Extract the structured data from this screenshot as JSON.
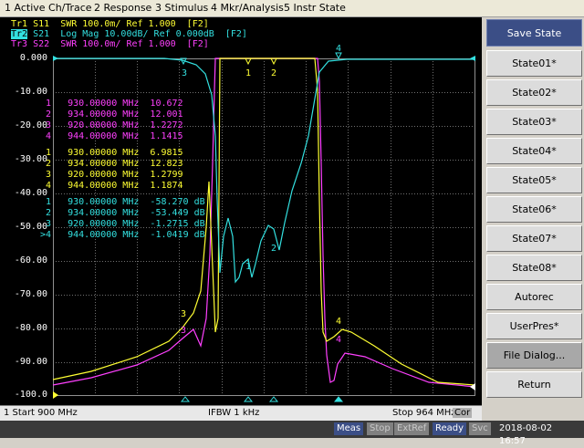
{
  "menu": [
    "1 Active Ch/Trace",
    "2 Response",
    "3 Stimulus",
    "4 Mkr/Analysis",
    "5 Instr State"
  ],
  "traces": [
    {
      "id": "Tr1",
      "text": "S11  SWR 100.0m/ Ref 1.000  [F2]",
      "color": "#ffff33"
    },
    {
      "id": "Tr2",
      "text": "S21  Log Mag 10.00dB/ Ref 0.000dB  [F2]",
      "color": "#33e0e0"
    },
    {
      "id": "Tr3",
      "text": "S22  SWR 100.0m/ Ref 1.000  [F2]",
      "color": "#ff40ff"
    }
  ],
  "y_axis_labels": [
    "0.000",
    "-10.00",
    "-20.00",
    "-30.00",
    "-40.00",
    "-50.00",
    "-60.00",
    "-70.00",
    "-80.00",
    "-90.00",
    "-100.0"
  ],
  "marker_tables": [
    {
      "color": "#ff40ff",
      "rows": [
        {
          "num": "1",
          "freq": "930.00000 MHz",
          "val": "10.672"
        },
        {
          "num": "2",
          "freq": "934.00000 MHz",
          "val": "12.001"
        },
        {
          "num": "3",
          "freq": "920.00000 MHz",
          "val": "1.2272"
        },
        {
          "num": "4",
          "freq": "944.00000 MHz",
          "val": "1.1415"
        }
      ]
    },
    {
      "color": "#ffff33",
      "rows": [
        {
          "num": "1",
          "freq": "930.00000 MHz",
          "val": "6.9815"
        },
        {
          "num": "2",
          "freq": "934.00000 MHz",
          "val": "12.823"
        },
        {
          "num": "3",
          "freq": "920.00000 MHz",
          "val": "1.2799"
        },
        {
          "num": "4",
          "freq": "944.00000 MHz",
          "val": "1.1874"
        }
      ]
    },
    {
      "color": "#33e0e0",
      "rows": [
        {
          "num": "1",
          "freq": "930.00000 MHz",
          "val": "-58.270 dB"
        },
        {
          "num": "2",
          "freq": "934.00000 MHz",
          "val": "-53.449 dB"
        },
        {
          "num": "3",
          "freq": "920.00000 MHz",
          "val": "-1.2715 dB"
        },
        {
          "num": "4",
          "freq": "944.00000 MHz",
          "val": "-1.0419 dB"
        }
      ]
    }
  ],
  "status": {
    "start": "1  Start 900 MHz",
    "ifbw": "IFBW 1 kHz",
    "stop": "Stop 964 MHz",
    "cor": "Cor"
  },
  "softkeys": [
    "Save State",
    "State01*",
    "State02*",
    "State03*",
    "State04*",
    "State05*",
    "State06*",
    "State07*",
    "State08*",
    "Autorec",
    "UserPres*",
    "File Dialog...",
    "Return"
  ],
  "bottom": {
    "meas": "Meas",
    "stop": "Stop",
    "extref": "ExtRef",
    "ready": "Ready",
    "svc": "Svc",
    "datetime": "2018-08-02 16:57"
  },
  "colors": {
    "s11": "#ffff33",
    "s21": "#33e0e0",
    "s22": "#ff40ff",
    "grid": "#707070"
  }
}
